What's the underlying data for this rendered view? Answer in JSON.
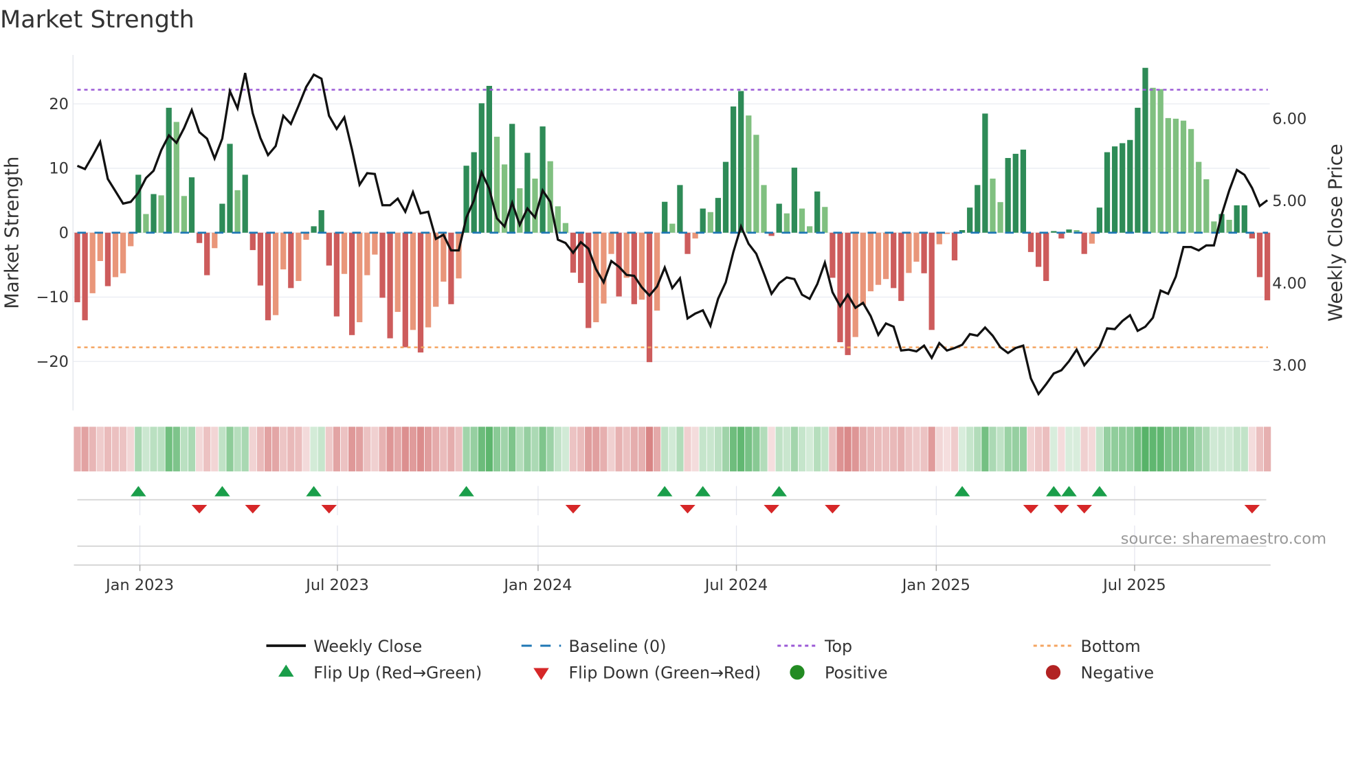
{
  "chart_data": {
    "type": "bar",
    "title": "Market Strength",
    "ylabel": "Market Strength",
    "y2label": "Weekly Close Price",
    "ylim": [
      -27.6,
      27.6
    ],
    "y2lim": [
      2.45,
      6.78
    ],
    "yticks": [
      20,
      10,
      0,
      -10,
      -20
    ],
    "ytick_labels": [
      "20",
      "10",
      "0",
      "−10",
      "−20"
    ],
    "y2ticks": [
      6,
      5,
      4,
      3
    ],
    "y2tick_labels": [
      "6.00",
      "5.00",
      "4.00",
      "3.00"
    ],
    "xtick_weeks": [
      8.2,
      34.1,
      60.4,
      86.4,
      112.6,
      138.6
    ],
    "xtick_labels": [
      "Jan 2023",
      "Jul 2023",
      "Jan 2024",
      "Jul 2024",
      "Jan 2025",
      "Jul 2025"
    ],
    "grid": true,
    "top_level": 22.2,
    "bottom_level": -17.8,
    "baseline": 0,
    "strength": [
      -10.8,
      -13.6,
      -9.4,
      -4.4,
      -8.3,
      -6.9,
      -6.3,
      -2.1,
      9.0,
      2.9,
      6.0,
      5.8,
      19.4,
      17.2,
      5.7,
      8.6,
      -1.6,
      -6.6,
      -2.4,
      4.5,
      13.8,
      6.6,
      9.0,
      -2.7,
      -8.2,
      -13.6,
      -12.8,
      -5.7,
      -8.6,
      -7.5,
      -1.1,
      1.0,
      3.5,
      -5.1,
      -13.0,
      -6.4,
      -15.9,
      -13.9,
      -6.6,
      -3.4,
      -10.1,
      -16.4,
      -12.3,
      -17.8,
      -15.1,
      -18.6,
      -14.7,
      -11.5,
      -7.6,
      -11.1,
      -7.1,
      10.4,
      12.5,
      20.1,
      22.8,
      14.9,
      10.6,
      16.9,
      6.9,
      12.4,
      8.4,
      16.5,
      11.1,
      4.1,
      1.5,
      -6.2,
      -7.8,
      -14.8,
      -13.9,
      -11.0,
      -3.3,
      -9.9,
      -7.0,
      -11.1,
      -10.4,
      -20.1,
      -12.1,
      4.8,
      1.4,
      7.4,
      -3.3,
      -0.9,
      3.75,
      3.2,
      5.4,
      11.0,
      19.6,
      22.0,
      18.2,
      15.2,
      7.4,
      -0.5,
      4.5,
      3.0,
      10.1,
      3.75,
      1.0,
      6.4,
      4.0,
      -7.0,
      -17.0,
      -19.0,
      -16.2,
      -11.25,
      -9.1,
      -8.1,
      -7.2,
      -8.6,
      -10.6,
      -6.25,
      -4.5,
      -6.3,
      -15.1,
      -1.8,
      -0.2,
      -4.3,
      0.4,
      3.9,
      7.4,
      18.5,
      8.4,
      4.75,
      11.6,
      12.25,
      12.9,
      -3.0,
      -5.3,
      -7.5,
      0.25,
      -0.9,
      0.5,
      0.4,
      -3.3,
      -1.7,
      3.9,
      12.5,
      13.4,
      13.9,
      14.4,
      19.4,
      25.6,
      22.5,
      22.3,
      17.8,
      17.7,
      17.4,
      16.1,
      11.0,
      8.3,
      1.75,
      2.9,
      2.0,
      4.25,
      4.25,
      -0.9,
      -6.9,
      -10.5
    ],
    "weekly_close": [
      5.43,
      5.39,
      5.55,
      5.72,
      5.27,
      5.12,
      4.97,
      4.99,
      5.1,
      5.28,
      5.37,
      5.62,
      5.8,
      5.71,
      5.89,
      6.11,
      5.84,
      5.76,
      5.52,
      5.76,
      6.34,
      6.13,
      6.56,
      6.07,
      5.77,
      5.56,
      5.67,
      6.04,
      5.94,
      6.16,
      6.39,
      6.54,
      6.49,
      6.04,
      5.88,
      6.02,
      5.63,
      5.2,
      5.34,
      5.33,
      4.95,
      4.95,
      5.03,
      4.87,
      5.11,
      4.85,
      4.87,
      4.54,
      4.59,
      4.4,
      4.4,
      4.8,
      5.01,
      5.35,
      5.15,
      4.79,
      4.69,
      4.98,
      4.71,
      4.91,
      4.8,
      5.13,
      4.99,
      4.53,
      4.49,
      4.37,
      4.5,
      4.42,
      4.17,
      4.01,
      4.27,
      4.2,
      4.1,
      4.09,
      3.95,
      3.85,
      3.96,
      4.19,
      3.94,
      4.06,
      3.57,
      3.63,
      3.67,
      3.48,
      3.81,
      4.01,
      4.38,
      4.69,
      4.48,
      4.36,
      4.12,
      3.87,
      4.0,
      4.07,
      4.05,
      3.86,
      3.81,
      3.99,
      4.25,
      3.89,
      3.72,
      3.86,
      3.7,
      3.76,
      3.6,
      3.37,
      3.51,
      3.47,
      3.18,
      3.19,
      3.17,
      3.24,
      3.09,
      3.27,
      3.18,
      3.21,
      3.25,
      3.38,
      3.36,
      3.46,
      3.36,
      3.22,
      3.15,
      3.21,
      3.24,
      2.84,
      2.65,
      2.77,
      2.9,
      2.94,
      3.05,
      3.19,
      3.0,
      3.11,
      3.22,
      3.45,
      3.44,
      3.54,
      3.61,
      3.42,
      3.47,
      3.58,
      3.91,
      3.87,
      4.08,
      4.44,
      4.44,
      4.4,
      4.46,
      4.46,
      4.83,
      5.13,
      5.38,
      5.32,
      5.16,
      4.94,
      5.01
    ],
    "flip_up_weeks": [
      9,
      20,
      32,
      52,
      78,
      83,
      93,
      117,
      129,
      131,
      135
    ],
    "flip_down_weeks": [
      17,
      24,
      34,
      66,
      81,
      92,
      100,
      126,
      130,
      133,
      155
    ],
    "legend_position": "bottom",
    "legend": [
      {
        "label": "Weekly Close",
        "symbol": "line",
        "color": "#111111"
      },
      {
        "label": "Baseline (0)",
        "symbol": "dash",
        "color": "#1f77b4"
      },
      {
        "label": "Top",
        "symbol": "dot",
        "color": "#9b59d6"
      },
      {
        "label": "Bottom",
        "symbol": "dot",
        "color": "#f4a460"
      },
      {
        "label": "Flip Up (Red→Green)",
        "symbol": "triangle-up",
        "color": "#1a9e4a"
      },
      {
        "label": "Flip Down (Green→Red)",
        "symbol": "triangle-down",
        "color": "#d62728"
      },
      {
        "label": "Positive",
        "symbol": "circle",
        "color": "#228b22"
      },
      {
        "label": "Negative",
        "symbol": "circle",
        "color": "#b22222"
      }
    ],
    "colors": {
      "pos_rising": "#2e8b57",
      "pos_falling": "#80c080",
      "neg_falling": "#cd5c5c",
      "neg_rising": "#e9967a"
    },
    "source": "source: sharemaestro.com"
  }
}
